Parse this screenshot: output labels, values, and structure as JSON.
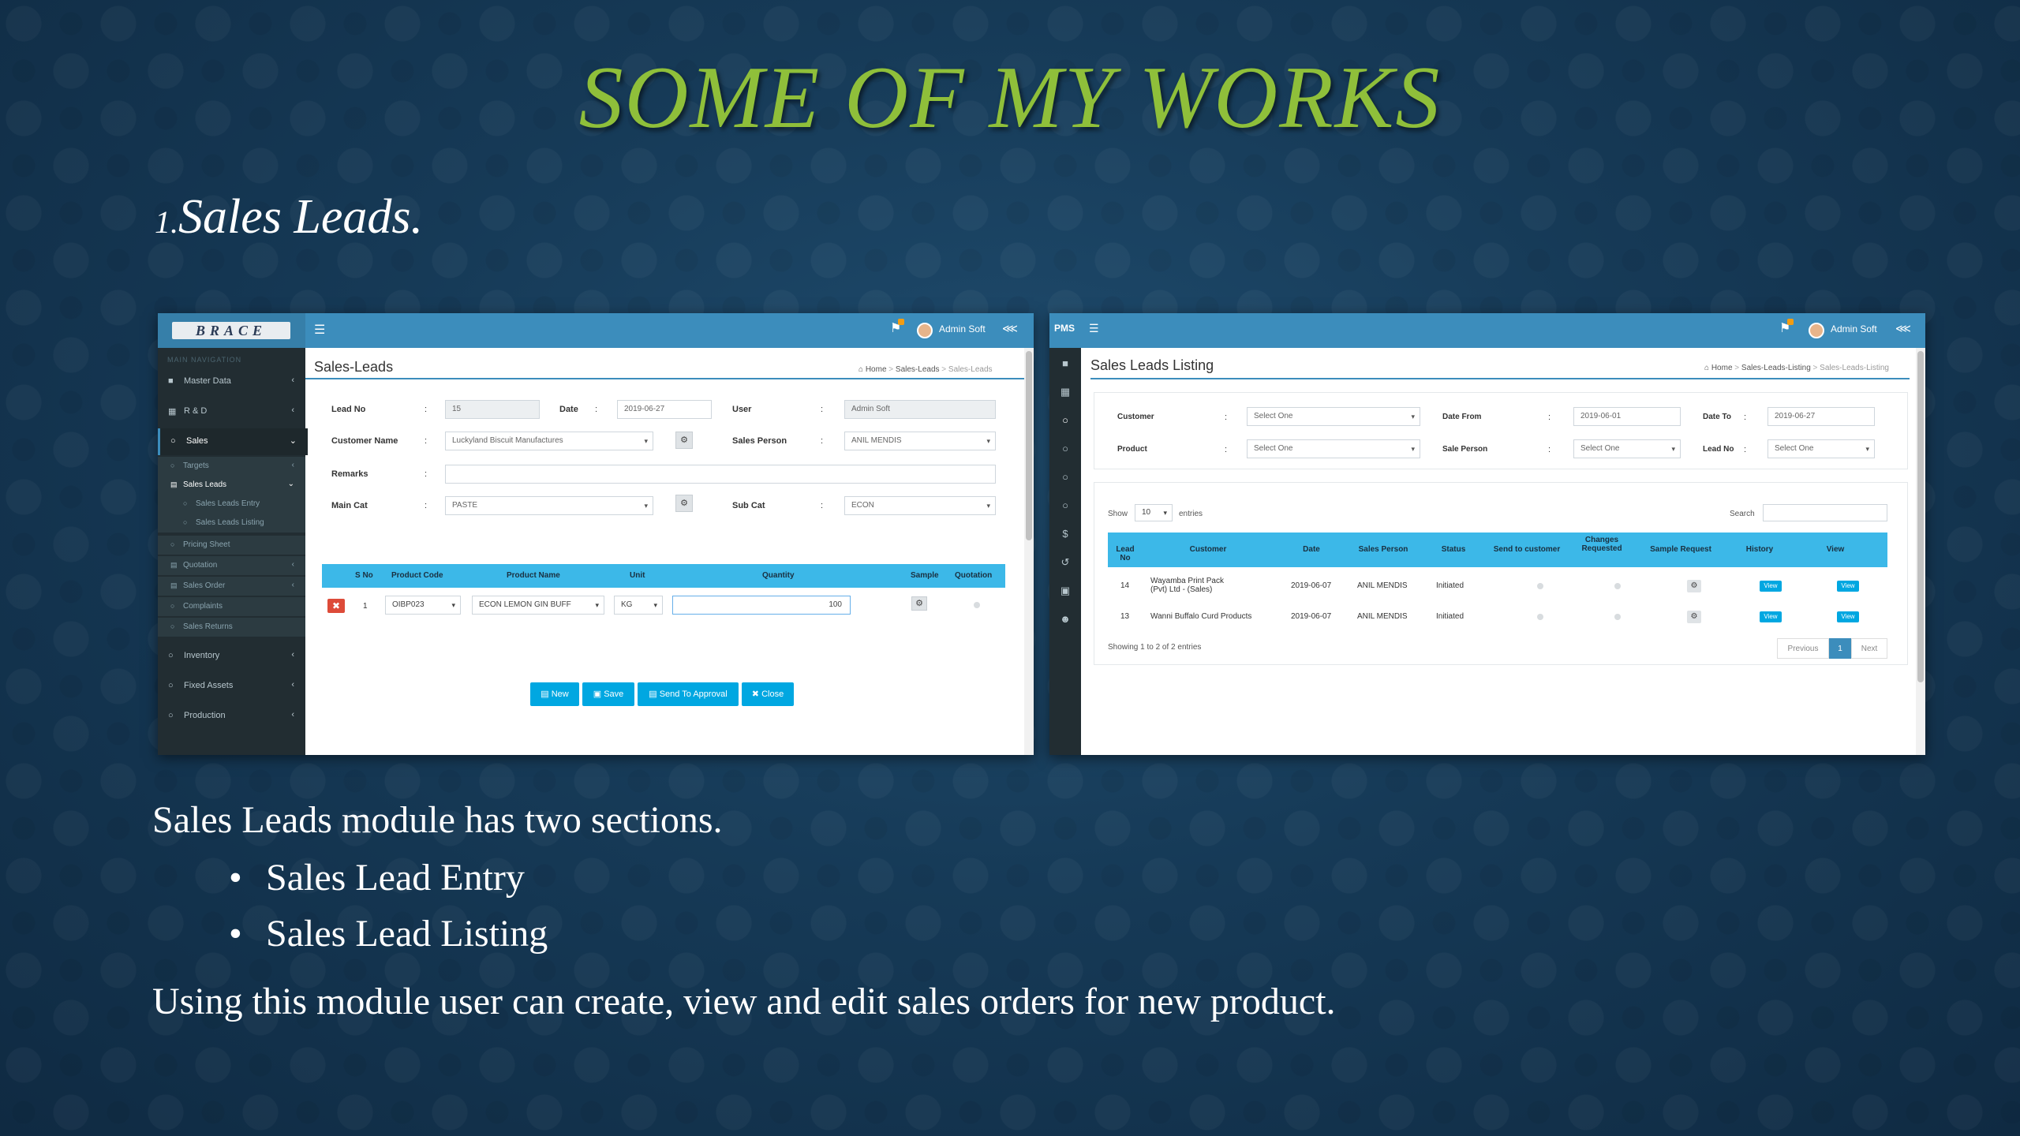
{
  "slide": {
    "title": "SOME OF MY WORKS",
    "subtitle_num": "1.",
    "subtitle": "Sales Leads.",
    "intro": "Sales Leads module has two sections.",
    "bullets": [
      "Sales Lead Entry",
      "Sales Lead Listing"
    ],
    "summary": "Using this module user can create, view and edit sales orders for new product."
  },
  "shot1": {
    "logo": "BRACE",
    "user": "Admin Soft",
    "sidebar_header": "MAIN NAVIGATION",
    "sidebar": [
      {
        "label": "Master Data"
      },
      {
        "label": "R & D"
      },
      {
        "label": "Sales"
      },
      {
        "label": "Inventory"
      },
      {
        "label": "Fixed Assets"
      },
      {
        "label": "Production"
      }
    ],
    "sales_sub": [
      "Targets",
      "Sales Leads",
      "Pricing Sheet",
      "Quotation",
      "Sales Order",
      "Complaints",
      "Sales Returns"
    ],
    "sales_leads_sub": [
      "Sales Leads Entry",
      "Sales Leads Listing"
    ],
    "page_title": "Sales-Leads",
    "crumbs": [
      "Home",
      "Sales-Leads",
      "Sales-Leads"
    ],
    "form": {
      "lead_no_label": "Lead No",
      "lead_no": "15",
      "date_label": "Date",
      "date": "2019-06-27",
      "user_label": "User",
      "user": "Admin Soft",
      "customer_label": "Customer Name",
      "customer": "Luckyland Biscuit Manufactures",
      "sales_person_label": "Sales Person",
      "sales_person": "ANIL MENDIS",
      "remarks_label": "Remarks",
      "remarks": "",
      "main_cat_label": "Main Cat",
      "main_cat": "PASTE",
      "sub_cat_label": "Sub Cat",
      "sub_cat": "ECON"
    },
    "table": {
      "headers": [
        "S No",
        "Product Code",
        "Product Name",
        "Unit",
        "Quantity",
        "Sample",
        "Quotation"
      ],
      "row": {
        "sno": "1",
        "code": "OIBP023",
        "name": "ECON LEMON GIN BUFF",
        "unit": "KG",
        "quantity": "100"
      }
    },
    "buttons": [
      "New",
      "Save",
      "Send To Approval",
      "Close"
    ]
  },
  "shot2": {
    "brand": "PMS",
    "user": "Admin Soft",
    "page_title": "Sales Leads Listing",
    "crumbs": [
      "Home",
      "Sales-Leads-Listing",
      "Sales-Leads-Listing"
    ],
    "filters": {
      "customer_label": "Customer",
      "customer": "Select One",
      "date_from_label": "Date From",
      "date_from": "2019-06-01",
      "date_to_label": "Date To",
      "date_to": "2019-06-27",
      "product_label": "Product",
      "product": "Select One",
      "sale_person_label": "Sale Person",
      "sale_person": "Select One",
      "lead_no_label": "Lead No",
      "lead_no": "Select One"
    },
    "show_label": "Show",
    "show_value": "10",
    "entries_label": "entries",
    "search_label": "Search",
    "headers": [
      "Lead No",
      "Customer",
      "Date",
      "Sales Person",
      "Status",
      "Send to customer",
      "Changes Requested",
      "Sample Request",
      "History",
      "View"
    ],
    "rows": [
      {
        "lead": "14",
        "customer": "Wayamba Print Pack (Pvt) Ltd - (Sales)",
        "date": "2019-06-07",
        "person": "ANIL MENDIS",
        "status": "Initiated",
        "history": "View",
        "view": "View"
      },
      {
        "lead": "13",
        "customer": "Wanni Buffalo Curd Products",
        "date": "2019-06-07",
        "person": "ANIL MENDIS",
        "status": "Initiated",
        "history": "View",
        "view": "View"
      }
    ],
    "showing": "Showing 1 to 2 of 2 entries",
    "pager": [
      "Previous",
      "1",
      "Next"
    ]
  },
  "colors": {
    "title_green": "#8fbf3a",
    "brand_blue": "#3c8dbc",
    "table_head": "#3cb8e8",
    "button": "#00a7e1"
  }
}
